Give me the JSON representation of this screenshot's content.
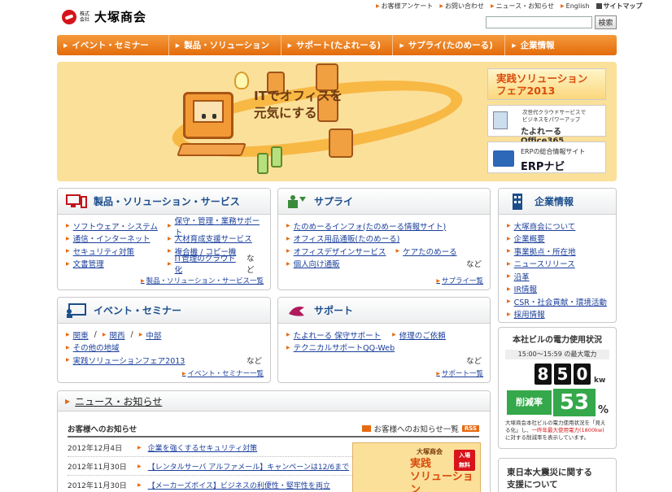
{
  "header": {
    "logo_small": "株式会社",
    "logo_name": "大塚商会",
    "utility": [
      "お客様アンケート",
      "お問い合わせ",
      "ニュース・お知らせ",
      "English"
    ],
    "sitemap": "サイトマップ",
    "search_value": "",
    "search_button": "検索"
  },
  "nav": [
    {
      "label": "イベント・セミナー"
    },
    {
      "label": "製品・ソリューション"
    },
    {
      "label": "サポート(たよれーる)"
    },
    {
      "label": "サプライ(たのめーる)"
    },
    {
      "label": "企業情報"
    }
  ],
  "hero": {
    "line1": "ITでオフィスを",
    "line2": "元気にする",
    "banner_fair_1": "実践ソリューション",
    "banner_fair_2": "フェア2013",
    "office_sub1": "次世代クラウドサービスで",
    "office_sub2": "ビジネスをパワーアップ",
    "office_main": "たよれーる Office365",
    "erp_sub": "ERPの総合情報サイト",
    "erp_main": "ERPナビ"
  },
  "products": {
    "title": "製品・ソリューション・サービス",
    "col1": [
      "ソフトウェア・システム",
      "通信・インターネット",
      "セキュリティ対策",
      "文書管理"
    ],
    "col2": [
      "保守・管理・業務サポート",
      "人材育成支援サービス",
      "複合機 / コピー機",
      "IT管理のクラウド化"
    ],
    "etc": "など",
    "more": "製品・ソリューション・サービス一覧"
  },
  "supply": {
    "title": "サプライ",
    "l1": "たのめーるインフォ(たのめーる情報サイト)",
    "l2": "オフィス用品通販(たのめーる)",
    "l3a": "オフィスデザインサービス",
    "l3b": "ケアたのめーる",
    "l4": "個人向け通販",
    "etc": "など",
    "more": "サプライ一覧"
  },
  "company": {
    "title": "企業情報",
    "items": [
      "大塚商会について",
      "企業概要",
      "事業拠点・所在地",
      "ニュースリリース",
      "沿革",
      "IR情報",
      "CSR・社会貢献・環境活動",
      "採用情報"
    ]
  },
  "events": {
    "title": "イベント・セミナー",
    "r1": [
      "関東",
      "関西",
      "中部"
    ],
    "slash": "/",
    "r2": "その他の地域",
    "r3": "実践ソリューションフェア2013",
    "etc": "など",
    "more": "イベント・セミナー一覧"
  },
  "support": {
    "title": "サポート",
    "l1a": "たよれーる 保守サポート",
    "l1b": "修理のご依頼",
    "l2": "テクニカルサポートQQ-Web",
    "etc": "など",
    "more": "サポート一覧"
  },
  "power": {
    "title": "本社ビルの電力使用状況",
    "time": "15:00～15:59 の最大電力",
    "digits": [
      "8",
      "5",
      "0"
    ],
    "unit": "kw",
    "cut_label": "削減率",
    "cut_value": "53",
    "pct": "%",
    "note1": "大塚商会本社ビルの電力使用状況",
    "note2": "を「見える化」し、",
    "note_red": "一昨年最大使用電力(1800kw)",
    "note3": "に対する削減率を表示しています。"
  },
  "quake": {
    "line1": "東日本大震災に関する",
    "line2": "支援について"
  },
  "news": {
    "title": "ニュース・お知らせ",
    "sub": "お客様へのお知らせ",
    "sub_link": "お客様へのお知らせ一覧",
    "rss": "RSS",
    "items": [
      {
        "date": "2012年12月4日",
        "text": "企業を強くするセキュリティ対策"
      },
      {
        "date": "2012年11月30日",
        "text": "【レンタルサーバ アルファメール】キャンペーンは12/6まで"
      },
      {
        "date": "2012年11月30日",
        "text": "【メーカーズボイス】ビジネスの利便性・堅牢性を両立"
      }
    ],
    "promo_a": "大塚商会",
    "promo_b1": "実践",
    "promo_b2": "ソリューション",
    "promo_tag1": "入場",
    "promo_tag2": "無料"
  }
}
